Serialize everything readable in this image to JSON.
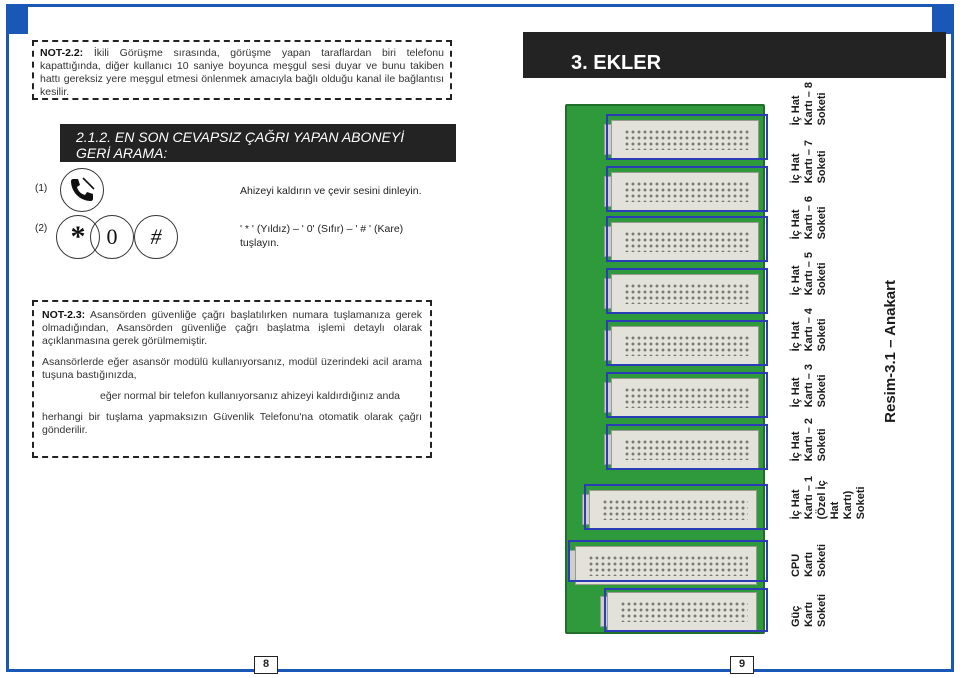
{
  "left_page": {
    "note_22": {
      "label": "NOT-2.2:",
      "text": " İkili Görüşme sırasında, görüşme yapan taraflardan biri telefonu kapattığında, diğer kullanıcı 10 saniye boyunca meşgul sesi duyar ve bunu takiben hattı gereksiz yere meşgul etmesi önlenmek amacıyla bağlı olduğu kanal ile bağlantısı kesilir."
    },
    "section": {
      "line1": "2.1.2. EN SON CEVAPSIZ ÇAĞRI YAPAN ABONEYİ",
      "line2": "GERİ ARAMA:"
    },
    "steps": [
      {
        "num": "(1)",
        "text": "Ahizeyi kaldırın ve çevir sesini dinleyin."
      },
      {
        "num": "(2)",
        "text_line1": "' * ' (Yıldız) – ' 0' (Sıfır) – ' # ' (Kare)",
        "text_line2": "tuşlayın."
      }
    ],
    "keys": [
      "*",
      "0",
      "#"
    ],
    "note_23": {
      "label": "NOT-2.3:",
      "text": " Asansörden güvenliğe çağrı başlatılırken numara tuşlamanıza gerek olmadığından, Asansörden güvenliğe çağrı başlatma işlemi detaylı olarak açıklanmasına gerek görülmemiştir.",
      "para2": "Asansörlerde eğer asansör modülü kullanıyorsanız, modül üzerindeki acil arama tuşuna bastığınızda,",
      "para3": "eğer normal bir telefon kullanıyorsanız ahizeyi kaldırdığınız anda",
      "para4": "herhangi bir tuşlama yapmaksızın Güvenlik Telefonu'na  otomatik olarak çağrı gönderilir."
    },
    "page_number": "8"
  },
  "right_page": {
    "heading": "3. EKLER",
    "slot_labels": [
      [
        "İç Hat",
        "Kartı – 8",
        "Soketi"
      ],
      [
        "İç Hat",
        "Kartı – 7",
        "Soketi"
      ],
      [
        "İç Hat",
        "Kartı – 6",
        "Soketi"
      ],
      [
        "İç Hat",
        "Kartı – 5",
        "Soketi"
      ],
      [
        "İç Hat",
        "Kartı – 4",
        "Soketi"
      ],
      [
        "İç Hat",
        "Kartı – 3",
        "Soketi"
      ],
      [
        "İç Hat",
        "Kartı – 2",
        "Soketi"
      ],
      [
        "İç Hat",
        "Kartı – 1",
        "(Özel İç",
        "Hat",
        "Kartı)",
        "Soketi"
      ],
      [
        "CPU",
        "Kartı",
        "Soketi"
      ],
      [
        "Güç",
        "Kartı",
        "Soketi"
      ]
    ],
    "caption": "Resim-3.1 – Anakart",
    "page_number": "9"
  },
  "colors": {
    "accent": "#1a58b8",
    "banner": "#232323",
    "pcb": "#2e9a3c",
    "highlight": "#2c3cb8"
  }
}
